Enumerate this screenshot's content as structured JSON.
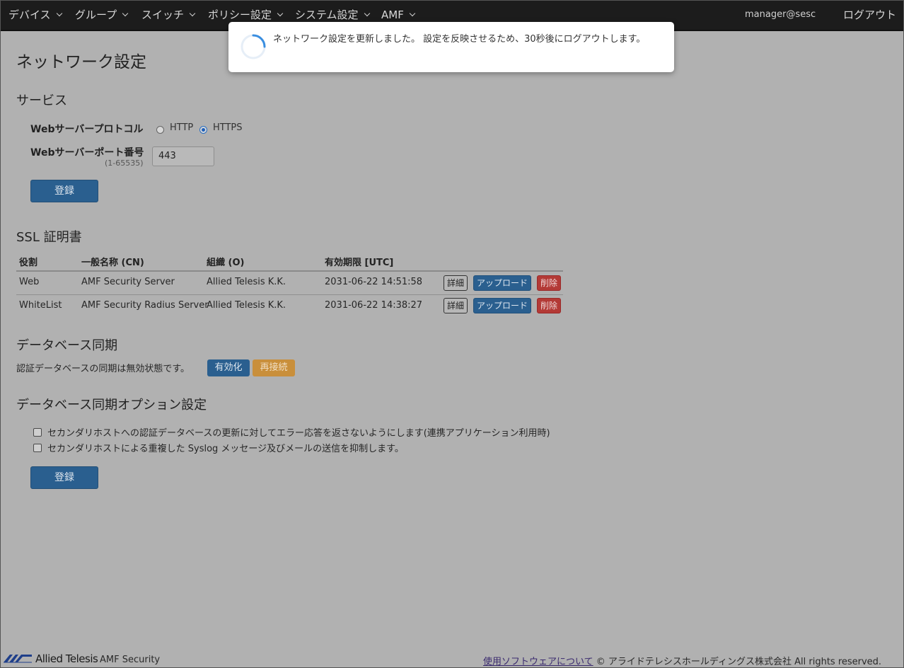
{
  "nav": {
    "items": [
      {
        "label": "デバイス"
      },
      {
        "label": "グループ"
      },
      {
        "label": "スイッチ"
      },
      {
        "label": "ポリシー設定"
      },
      {
        "label": "システム設定"
      },
      {
        "label": "AMF"
      }
    ],
    "user": "manager@sesc",
    "logout": "ログアウト"
  },
  "toast": {
    "message": "ネットワーク設定を更新しました。 設定を反映させるため、30秒後にログアウトします。"
  },
  "page": {
    "title": "ネットワーク設定"
  },
  "service": {
    "heading": "サービス",
    "protocol_label": "Webサーバープロトコル",
    "protocol_options": [
      "HTTP",
      "HTTPS"
    ],
    "protocol_selected": "HTTPS",
    "port_label": "Webサーバーポート番号",
    "port_range": "(1-65535)",
    "port_value": "443",
    "submit_label": "登録"
  },
  "ssl": {
    "heading": "SSL 証明書",
    "columns": [
      "役割",
      "一般名称 (CN)",
      "組織 (O)",
      "有効期限 [UTC]"
    ],
    "rows": [
      {
        "role": "Web",
        "cn": "AMF Security Server",
        "org": "Allied Telesis K.K.",
        "expiry": "2031-06-22 14:51:58"
      },
      {
        "role": "WhiteList",
        "cn": "AMF Security Radius Server",
        "org": "Allied Telesis K.K.",
        "expiry": "2031-06-22 14:38:27"
      }
    ],
    "detail_label": "詳細",
    "upload_label": "アップロード",
    "delete_label": "削除"
  },
  "dbsync": {
    "heading": "データベース同期",
    "status_text": "認証データベースの同期は無効状態です。",
    "enable_label": "有効化",
    "reconnect_label": "再接続"
  },
  "dbsync_options": {
    "heading": "データベース同期オプション設定",
    "options": [
      {
        "label": "セカンダリホストへの認証データベースの更新に対してエラー応答を返さないようにします(連携アプリケーション利用時)",
        "checked": false
      },
      {
        "label": "セカンダリホストによる重複した Syslog メッセージ及びメールの送信を抑制します。",
        "checked": false
      }
    ],
    "submit_label": "登録"
  },
  "footer": {
    "brand": "Allied Telesis",
    "product": "AMF Security",
    "software_link": "使用ソフトウェアについて",
    "copyright": "© アライドテレシスホールディングス株式会社 All rights reserved."
  },
  "colors": {
    "navbar": "#1c1c1c",
    "primary": "#2a5f8f",
    "danger": "#b33a36",
    "warning": "#c98f3b",
    "overlay": "#b1b1b1"
  }
}
